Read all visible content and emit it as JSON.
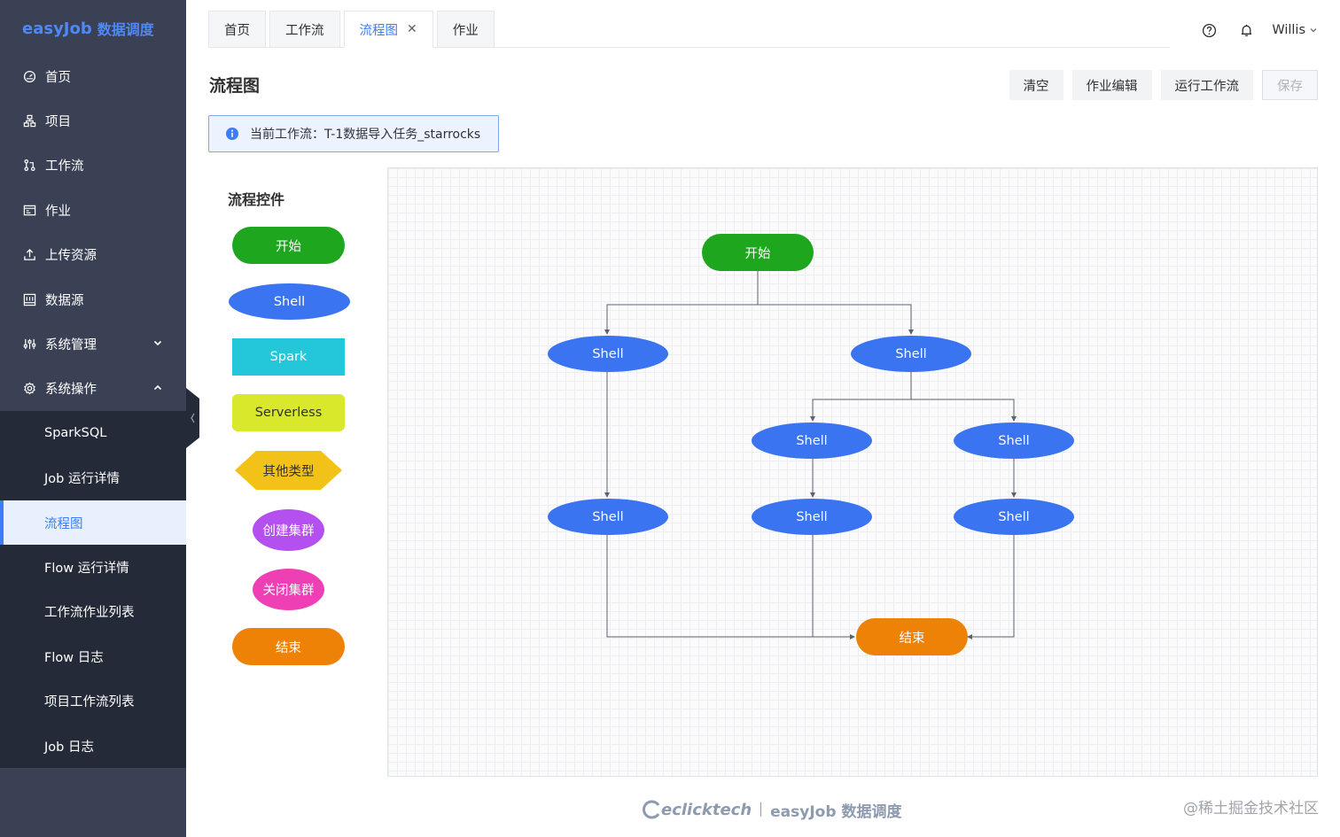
{
  "brand": {
    "name_en": "easyJob",
    "name_cn": "数据调度"
  },
  "sidebar": {
    "items": [
      {
        "label": "首页",
        "icon": "dashboard-icon"
      },
      {
        "label": "项目",
        "icon": "project-icon"
      },
      {
        "label": "工作流",
        "icon": "workflow-icon"
      },
      {
        "label": "作业",
        "icon": "job-icon"
      },
      {
        "label": "上传资源",
        "icon": "upload-icon"
      },
      {
        "label": "数据源",
        "icon": "datasource-icon"
      },
      {
        "label": "系统管理",
        "icon": "system-manage-icon",
        "expanded": false
      },
      {
        "label": "系统操作",
        "icon": "settings-icon",
        "expanded": true
      }
    ],
    "sub_items": [
      {
        "label": "SparkSQL"
      },
      {
        "label": "Job 运行详情"
      },
      {
        "label": "流程图",
        "active": true
      },
      {
        "label": "Flow 运行详情"
      },
      {
        "label": "工作流作业列表"
      },
      {
        "label": "Flow 日志"
      },
      {
        "label": "项目工作流列表"
      },
      {
        "label": "Job 日志"
      }
    ]
  },
  "tabs": [
    {
      "label": "首页"
    },
    {
      "label": "工作流"
    },
    {
      "label": "流程图",
      "active": true,
      "closable": true
    },
    {
      "label": "作业"
    }
  ],
  "header": {
    "user": "Willis",
    "help_icon": "help-icon",
    "bell_icon": "bell-icon"
  },
  "page": {
    "title": "流程图",
    "actions": {
      "clear": "清空",
      "edit_job": "作业编辑",
      "run": "运行工作流",
      "save": "保存"
    },
    "current_workflow": "当前工作流：T-1数据导入任务_starrocks"
  },
  "palette": {
    "title": "流程控件",
    "items": [
      {
        "label": "开始",
        "shape": "pill",
        "color": "#1fa61f"
      },
      {
        "label": "Shell",
        "shape": "ellipse",
        "color": "#3b74f0"
      },
      {
        "label": "Spark",
        "shape": "rect",
        "color": "#24c6da"
      },
      {
        "label": "Serverless",
        "shape": "rounded-rect",
        "color": "#d9e82b"
      },
      {
        "label": "其他类型",
        "shape": "hexagon",
        "color": "#f3c219"
      },
      {
        "label": "创建集群",
        "shape": "circle",
        "color": "#b44ff0"
      },
      {
        "label": "关闭集群",
        "shape": "circle",
        "color": "#ee3fb4"
      },
      {
        "label": "结束",
        "shape": "pill",
        "color": "#ee8206"
      }
    ]
  },
  "graph": {
    "nodes": [
      {
        "id": "start",
        "label": "开始",
        "type": "start"
      },
      {
        "id": "s1",
        "label": "Shell",
        "type": "shell"
      },
      {
        "id": "s2",
        "label": "Shell",
        "type": "shell"
      },
      {
        "id": "s3",
        "label": "Shell",
        "type": "shell"
      },
      {
        "id": "s4",
        "label": "Shell",
        "type": "shell"
      },
      {
        "id": "s5",
        "label": "Shell",
        "type": "shell"
      },
      {
        "id": "s6",
        "label": "Shell",
        "type": "shell"
      },
      {
        "id": "s7",
        "label": "Shell",
        "type": "shell"
      },
      {
        "id": "end",
        "label": "结束",
        "type": "end"
      }
    ],
    "edges": [
      [
        "start",
        "s1"
      ],
      [
        "start",
        "s2"
      ],
      [
        "s2",
        "s3"
      ],
      [
        "s2",
        "s4"
      ],
      [
        "s1",
        "s5"
      ],
      [
        "s3",
        "s6"
      ],
      [
        "s4",
        "s7"
      ],
      [
        "s5",
        "end"
      ],
      [
        "s6",
        "end"
      ],
      [
        "s7",
        "end"
      ]
    ]
  },
  "footer": {
    "company": "eclicktech",
    "product": "easyJob 数据调度",
    "watermark": "@稀土掘金技术社区"
  }
}
